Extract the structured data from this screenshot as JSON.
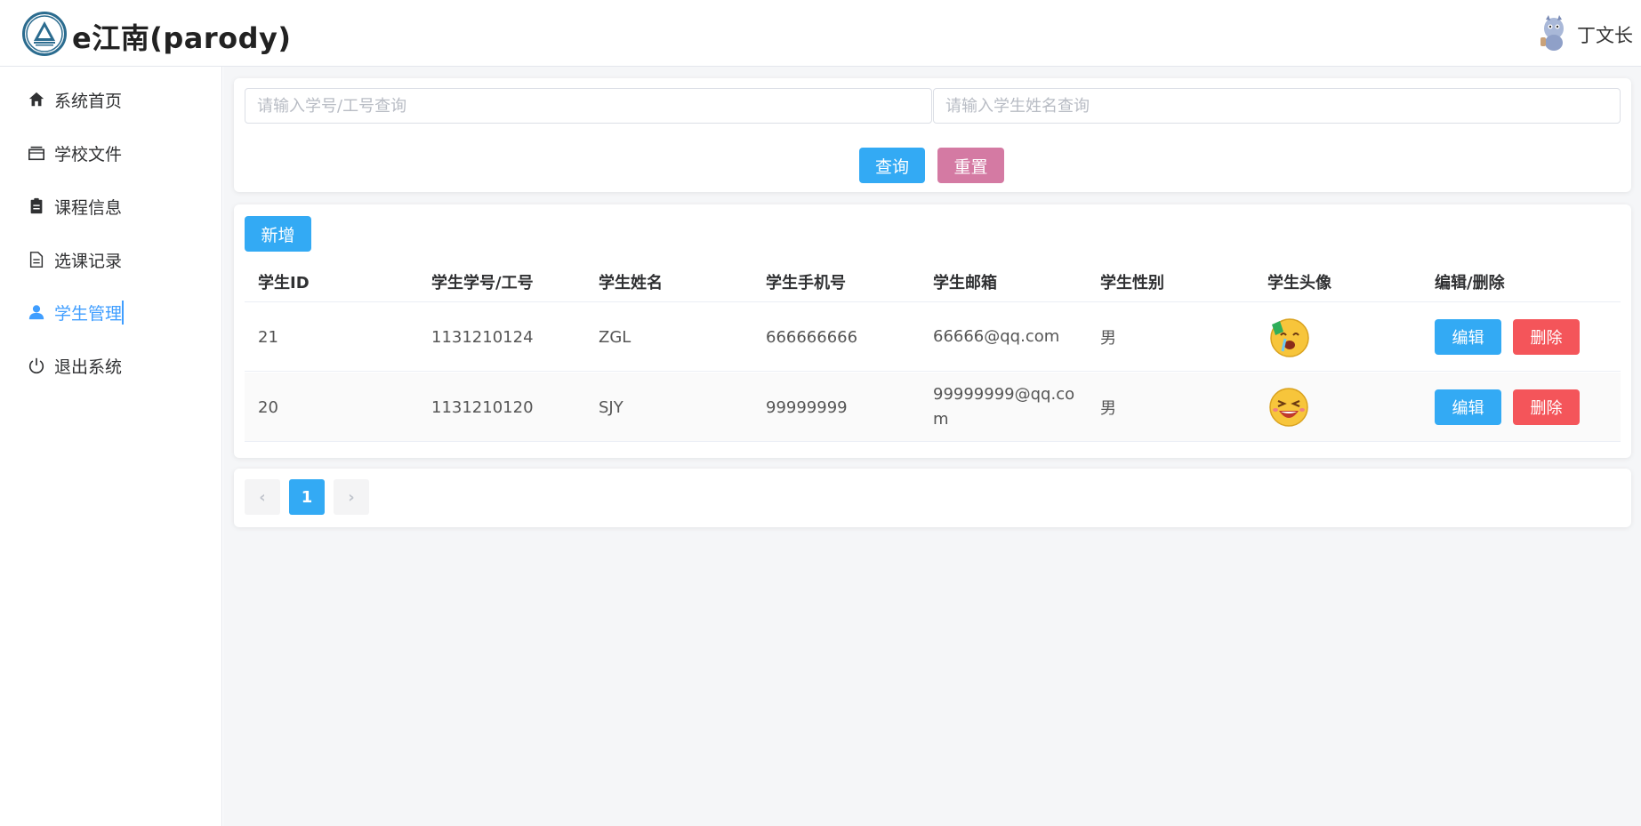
{
  "app": {
    "brand": "e江南(parody)",
    "user_name": "丁文长"
  },
  "sidebar": {
    "items": [
      {
        "label": "系统首页",
        "icon": "home-icon"
      },
      {
        "label": "学校文件",
        "icon": "folder-icon"
      },
      {
        "label": "课程信息",
        "icon": "clipboard-icon"
      },
      {
        "label": "选课记录",
        "icon": "document-icon"
      },
      {
        "label": "学生管理",
        "icon": "user-icon",
        "active": true
      },
      {
        "label": "退出系统",
        "icon": "power-icon"
      }
    ]
  },
  "search": {
    "id_placeholder": "请输入学号/工号查询",
    "name_placeholder": "请输入学生姓名查询",
    "query_label": "查询",
    "reset_label": "重置"
  },
  "toolbar": {
    "add_label": "新增"
  },
  "table": {
    "headers": [
      "学生ID",
      "学生学号/工号",
      "学生姓名",
      "学生手机号",
      "学生邮箱",
      "学生性别",
      "学生头像",
      "编辑/删除"
    ],
    "rows": [
      {
        "id": "21",
        "number": "1131210124",
        "name": "ZGL",
        "phone": "666666666",
        "email": "66666@qq.com",
        "gender": "男",
        "avatar": "crying-emoji-icon",
        "edit": "编辑",
        "delete": "删除"
      },
      {
        "id": "20",
        "number": "1131210120",
        "name": "SJY",
        "phone": "99999999",
        "email": "99999999@qq.com",
        "gender": "男",
        "avatar": "laughing-emoji-icon",
        "edit": "编辑",
        "delete": "删除"
      }
    ]
  },
  "pagination": {
    "current_page": "1",
    "prev": "‹",
    "next": "›"
  },
  "colors": {
    "primary": "#33aaf4",
    "reset": "#d47aa3",
    "danger": "#f4555a",
    "active_nav": "#409eff"
  }
}
